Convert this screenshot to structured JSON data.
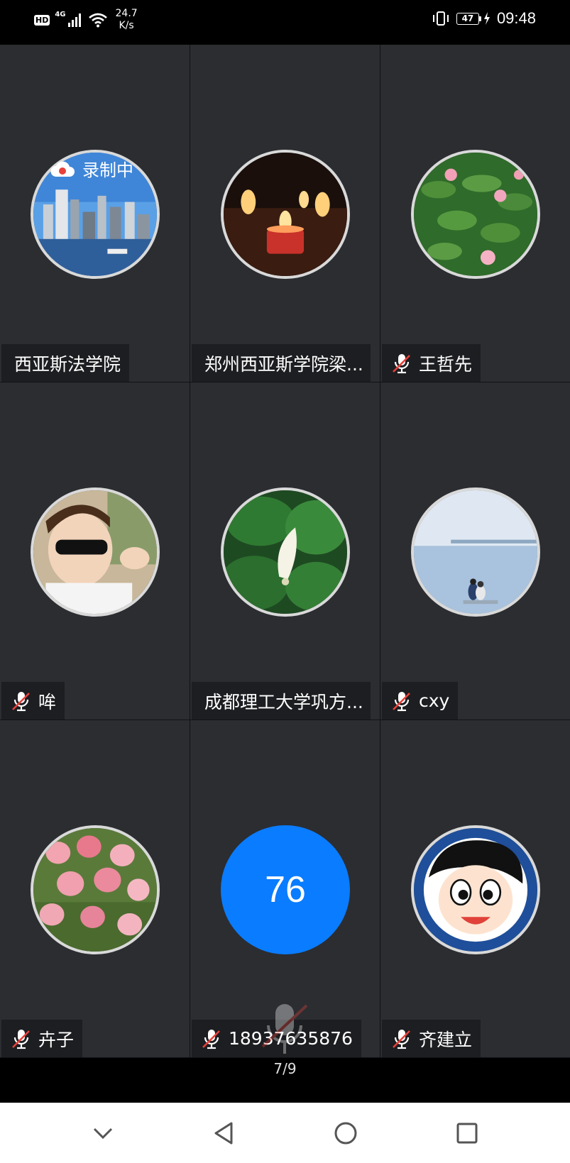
{
  "status_bar": {
    "hd": "HD",
    "network": "4G",
    "speed_value": "24.7",
    "speed_unit": "K/s",
    "battery": "47",
    "time": "09:48"
  },
  "recording_label": "录制中",
  "tiles": [
    {
      "name": "西亚斯法学院",
      "muted": false,
      "avatar": "city-skyline"
    },
    {
      "name": "郑州西亚斯学院梁...",
      "muted": false,
      "avatar": "candles"
    },
    {
      "name": "王哲先",
      "muted": true,
      "avatar": "water-lilies"
    },
    {
      "name": "哞",
      "muted": true,
      "avatar": "child-sunglasses"
    },
    {
      "name": "成都理工大学巩方...",
      "muted": false,
      "avatar": "white-flower-leaves"
    },
    {
      "name": "cxy",
      "muted": true,
      "avatar": "couple-by-lake"
    },
    {
      "name": "卉子",
      "muted": true,
      "avatar": "pink-tulips"
    },
    {
      "name": "18937635876",
      "muted": true,
      "avatar_text": "76"
    },
    {
      "name": "齐建立",
      "muted": true,
      "avatar": "cartoon-boy"
    }
  ],
  "page_indicator": "7/9",
  "colors": {
    "tile_bg": "#2b2d31",
    "avatar_blue": "#0a7cff",
    "mute_red": "#e8413a"
  }
}
